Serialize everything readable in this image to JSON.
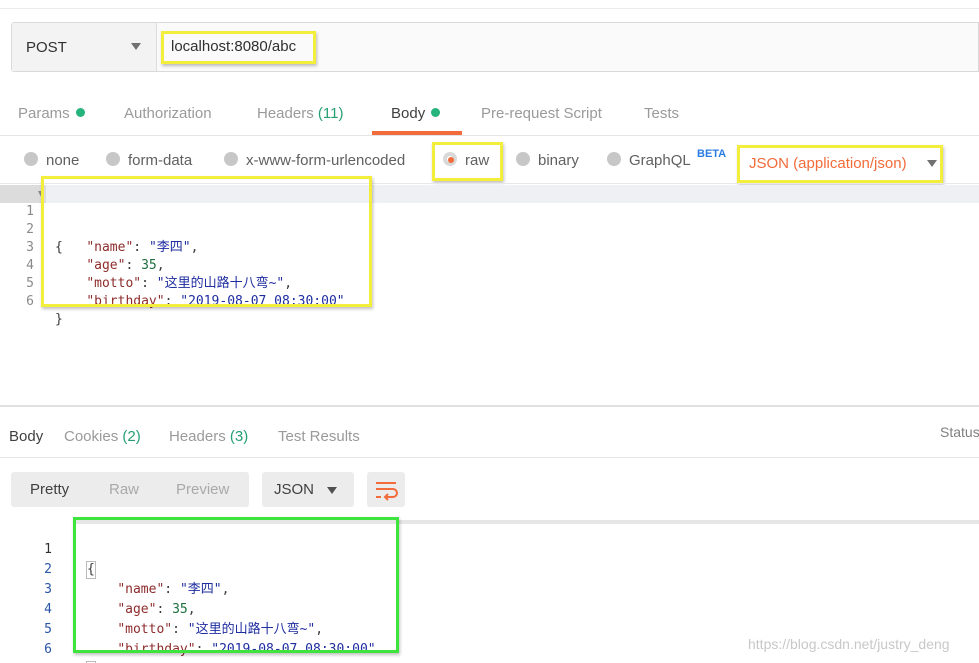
{
  "request": {
    "method": "POST",
    "url": "localhost:8080/abc"
  },
  "request_tabs": [
    {
      "label": "Params",
      "count": "",
      "dot": true
    },
    {
      "label": "Authorization",
      "count": "",
      "dot": false
    },
    {
      "label": "Headers",
      "count": "(11)",
      "dot": false
    },
    {
      "label": "Body",
      "count": "",
      "dot": true
    },
    {
      "label": "Pre-request Script",
      "count": "",
      "dot": false
    },
    {
      "label": "Tests",
      "count": "",
      "dot": false
    }
  ],
  "body_types": [
    {
      "label": "none",
      "selected": false
    },
    {
      "label": "form-data",
      "selected": false
    },
    {
      "label": "x-www-form-urlencoded",
      "selected": false
    },
    {
      "label": "raw",
      "selected": true
    },
    {
      "label": "binary",
      "selected": false
    },
    {
      "label": "GraphQL",
      "selected": false
    }
  ],
  "graphql_badge": "BETA",
  "content_type": "JSON (application/json)",
  "request_body": {
    "line_numbers": [
      "1",
      "2",
      "3",
      "4",
      "5",
      "6"
    ],
    "open_brace": "{",
    "close_brace": "}",
    "fields": [
      {
        "key": "\"name\"",
        "value": "\"李四\"",
        "type": "string",
        "trail": ","
      },
      {
        "key": "\"age\"",
        "value": "35",
        "type": "number",
        "trail": ","
      },
      {
        "key": "\"motto\"",
        "value": "\"这里的山路十八弯~\"",
        "type": "string",
        "trail": ","
      },
      {
        "key": "\"birthday\"",
        "value": "\"2019-08-07 08:30:00\"",
        "type": "string",
        "trail": ""
      }
    ]
  },
  "response_tabs": [
    {
      "label": "Body",
      "count": ""
    },
    {
      "label": "Cookies",
      "count": "(2)"
    },
    {
      "label": "Headers",
      "count": "(3)"
    },
    {
      "label": "Test Results",
      "count": ""
    }
  ],
  "status_label": "Status",
  "view_modes": [
    "Pretty",
    "Raw",
    "Preview"
  ],
  "response_format": "JSON",
  "response_body": {
    "line_numbers": [
      "1",
      "2",
      "3",
      "4",
      "5",
      "6"
    ],
    "open_brace": "{",
    "close_brace": "}",
    "fields": [
      {
        "key": "\"name\"",
        "value": "\"李四\"",
        "type": "string",
        "trail": ","
      },
      {
        "key": "\"age\"",
        "value": "35",
        "type": "number",
        "trail": ","
      },
      {
        "key": "\"motto\"",
        "value": "\"这里的山路十八弯~\"",
        "type": "string",
        "trail": ","
      },
      {
        "key": "\"birthday\"",
        "value": "\"2019-08-07 08:30:00\"",
        "type": "string",
        "trail": ""
      }
    ]
  },
  "watermark": "https://blog.csdn.net/justry_deng",
  "colors": {
    "accent": "#f26b3a",
    "count_green": "#26a073",
    "highlight_yellow": "#f2ee3b",
    "highlight_green": "#3fe33d"
  },
  "icons": {
    "method_caret": "chevron-down-icon",
    "content_type_caret": "chevron-down-icon",
    "format_caret": "chevron-down-icon",
    "wrap": "wrap-lines-icon",
    "fold": "fold-arrow-icon"
  }
}
